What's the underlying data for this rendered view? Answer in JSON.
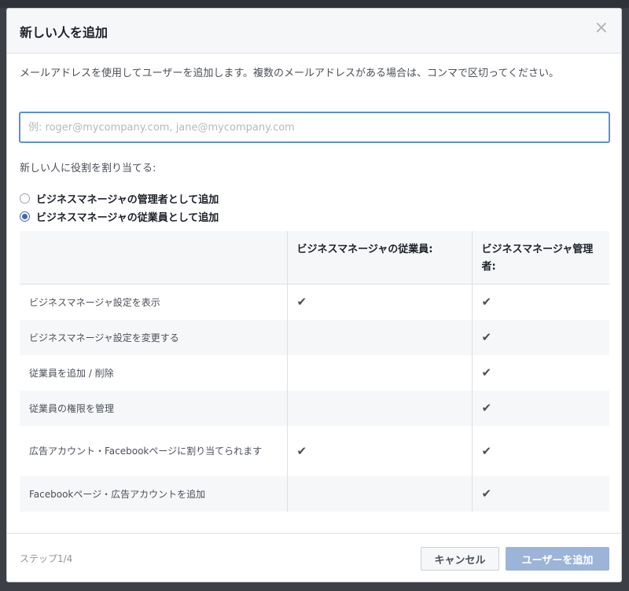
{
  "dialog": {
    "title": "新しい人を追加",
    "close_icon": "×",
    "description": "メールアドレスを使用してユーザーを追加します。複数のメールアドレスがある場合は、コンマで区切ってください。",
    "email_placeholder": "例: roger@mycompany.com, jane@mycompany.com",
    "email_value": "",
    "role_label": "新しい人に役割を割り当てる:",
    "roles": [
      {
        "label": "ビジネスマネージャの管理者として追加",
        "checked": false
      },
      {
        "label": "ビジネスマネージャの従業員として追加",
        "checked": true
      }
    ],
    "table": {
      "headers": [
        "",
        "ビジネスマネージャの従業員:",
        "ビジネスマネージャ管理者:"
      ],
      "rows": [
        {
          "label": "ビジネスマネージャ設定を表示",
          "employee": true,
          "admin": true
        },
        {
          "label": "ビジネスマネージャ設定を変更する",
          "employee": false,
          "admin": true
        },
        {
          "label": "従業員を追加 / 削除",
          "employee": false,
          "admin": true
        },
        {
          "label": "従業員の権限を管理",
          "employee": false,
          "admin": true
        },
        {
          "label": "広告アカウント・Facebookページに割り当てられます",
          "employee": true,
          "admin": true
        },
        {
          "label": "Facebookページ・広告アカウントを追加",
          "employee": false,
          "admin": true
        }
      ],
      "check_glyph": "✔"
    },
    "footer": {
      "step": "ステップ1/4",
      "cancel_label": "キャンセル",
      "add_label": "ユーザーを追加"
    }
  },
  "colors": {
    "accent": "#4267b2",
    "input_focus": "#5b8fd6",
    "primary_disabled": "#9cb4d8"
  }
}
